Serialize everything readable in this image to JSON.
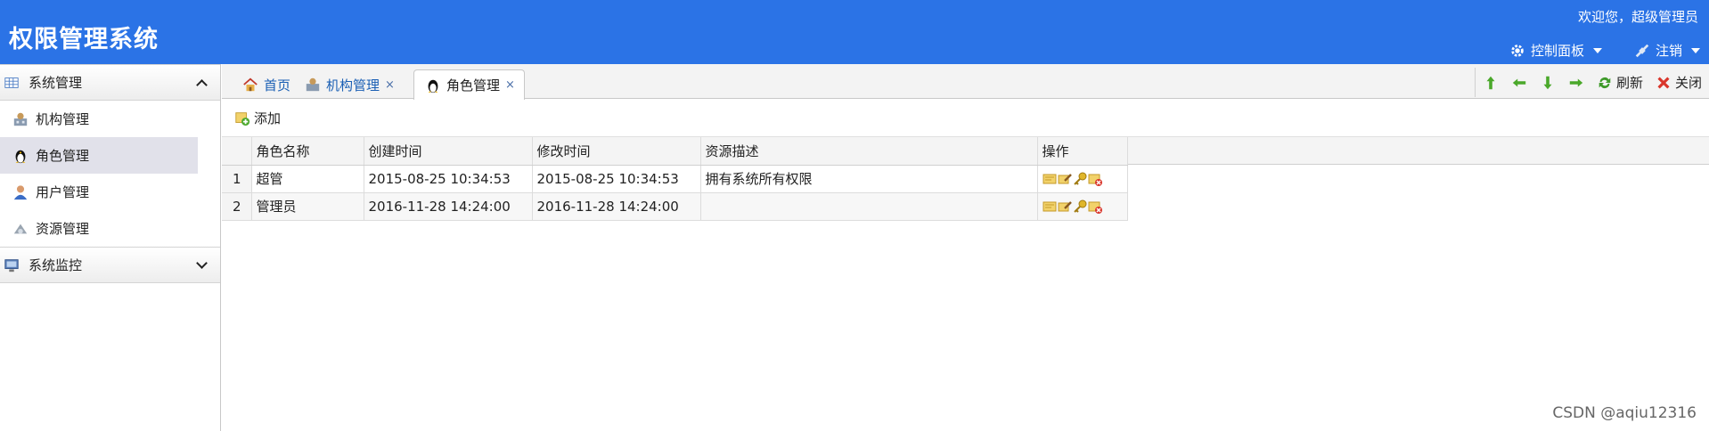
{
  "header": {
    "title": "权限管理系统",
    "welcome": "欢迎您，超级管理员",
    "control_panel": "控制面板",
    "logout": "注销"
  },
  "sidebar": {
    "groups": [
      {
        "label": "系统管理",
        "expanded": true
      },
      {
        "label": "系统监控",
        "expanded": false
      }
    ],
    "items": [
      {
        "label": "机构管理",
        "icon": "org-icon"
      },
      {
        "label": "角色管理",
        "icon": "penguin-icon",
        "active": true
      },
      {
        "label": "用户管理",
        "icon": "user-icon"
      },
      {
        "label": "资源管理",
        "icon": "resource-icon"
      }
    ]
  },
  "tabs": [
    {
      "label": "首页",
      "icon": "home-icon"
    },
    {
      "label": "机构管理",
      "icon": "org-icon",
      "closable": true
    },
    {
      "label": "角色管理",
      "icon": "penguin-icon",
      "closable": true,
      "active": true
    }
  ],
  "tab_close_glyph": "×",
  "tab_tools": {
    "refresh": "刷新",
    "close": "关闭"
  },
  "toolbar": {
    "add_label": "添加"
  },
  "grid": {
    "columns": [
      "角色名称",
      "创建时间",
      "修改时间",
      "资源描述",
      "操作"
    ],
    "rows": [
      {
        "num": "1",
        "name": "超管",
        "created": "2015-08-25 10:34:53",
        "modified": "2015-08-25 10:34:53",
        "desc": "拥有系统所有权限"
      },
      {
        "num": "2",
        "name": "管理员",
        "created": "2016-11-28 14:24:00",
        "modified": "2016-11-28 14:24:00",
        "desc": ""
      }
    ]
  },
  "watermark": "CSDN @aqiu12316",
  "colors": {
    "header_bg": "#2b73e6",
    "link": "#1a5fb4",
    "arrow_green": "#4aa82a",
    "close_red": "#d9362b"
  }
}
